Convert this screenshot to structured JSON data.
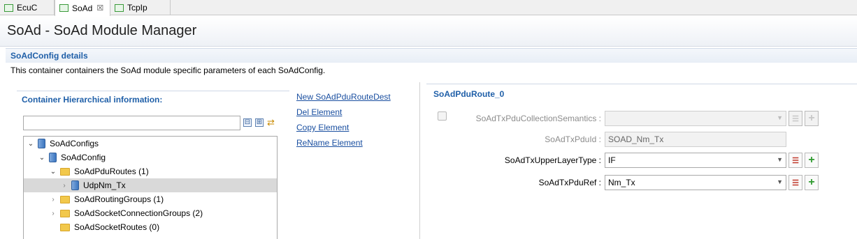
{
  "tabs": [
    {
      "label": "EcuC"
    },
    {
      "label": "SoAd",
      "close": "☒"
    },
    {
      "label": "TcpIp"
    }
  ],
  "header": {
    "title": "SoAd - SoAd Module Manager"
  },
  "section": {
    "title": "SoAdConfig details",
    "description": "This container containers the SoAd module specific parameters of each SoAdConfig."
  },
  "hierarchy": {
    "title": "Container Hierarchical information:",
    "filter_value": "",
    "collapse_glyph": "⊟",
    "expand_glyph": "⊞",
    "link_glyph": "⇄",
    "tree": [
      {
        "label": "SoAdConfigs",
        "arrow": "⌄",
        "icon": "container-icon"
      },
      {
        "label": "SoAdConfig",
        "arrow": "⌄",
        "icon": "container-icon"
      },
      {
        "label": "SoAdPduRoutes (1)",
        "arrow": "⌄",
        "icon": "folder-icon"
      },
      {
        "label": "UdpNm_Tx",
        "arrow": "›",
        "icon": "container-icon",
        "selected": true
      },
      {
        "label": "SoAdRoutingGroups (1)",
        "arrow": "›",
        "icon": "folder-icon"
      },
      {
        "label": "SoAdSocketConnectionGroups (2)",
        "arrow": "›",
        "icon": "folder-icon"
      },
      {
        "label": "SoAdSocketRoutes (0)",
        "arrow": "",
        "icon": "folder-icon"
      }
    ]
  },
  "actions": [
    {
      "label": "New SoAdPduRouteDest"
    },
    {
      "label": "Del Element"
    },
    {
      "label": "Copy Element"
    },
    {
      "label": "ReName Element"
    }
  ],
  "detail": {
    "title": "SoAdPduRoute_0",
    "fields": [
      {
        "label": "SoAdTxPduCollectionSemantics :",
        "value": "",
        "type": "combo",
        "enabled": false
      },
      {
        "label": "SoAdTxPduId :",
        "value": "SOAD_Nm_Tx",
        "type": "text",
        "enabled": false
      },
      {
        "label": "SoAdTxUpperLayerType :",
        "value": "IF",
        "type": "combo",
        "enabled": true
      },
      {
        "label": "SoAdTxPduRef :",
        "value": "Nm_Tx",
        "type": "combo",
        "enabled": true
      }
    ],
    "list_glyph": "☰",
    "plus_glyph": "+"
  },
  "colors": {
    "accent": "#1f5fa8",
    "link": "#1a4fa0",
    "selection": "#d9d9d9"
  }
}
